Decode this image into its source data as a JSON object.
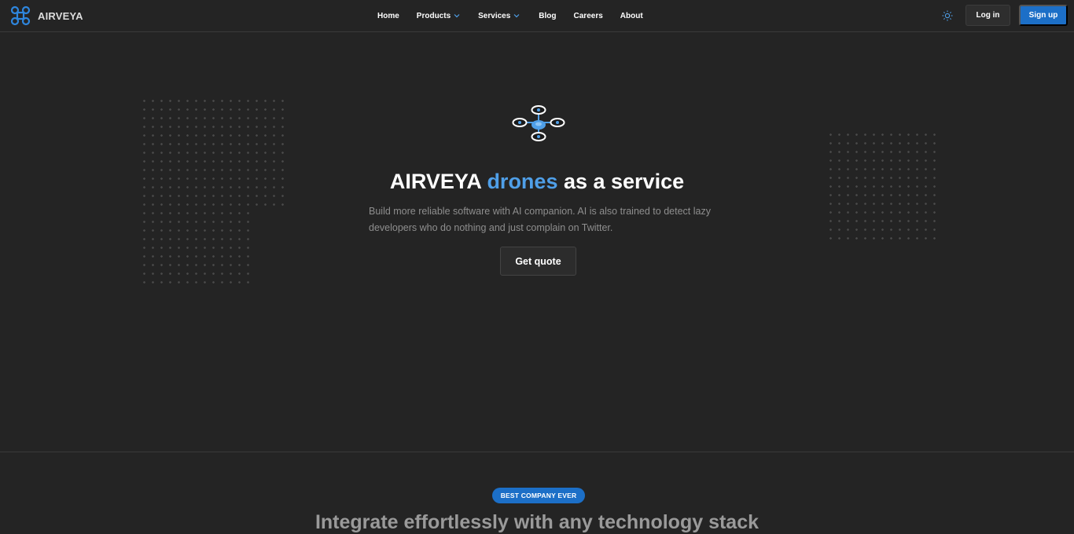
{
  "header": {
    "brand": "AIRVEYA",
    "nav": [
      {
        "label": "Home"
      },
      {
        "label": "Products"
      },
      {
        "label": "Services"
      },
      {
        "label": "Blog"
      },
      {
        "label": "Careers"
      },
      {
        "label": "About"
      }
    ],
    "login_label": "Log in",
    "signup_label": "Sign up",
    "theme_icon": "sun-icon"
  },
  "hero": {
    "title_prefix": "AIRVEYA ",
    "title_accent": "drones",
    "title_suffix": " as a service",
    "subtitle": "Build more reliable software with AI companion. AI is also trained to detect lazy developers who do nothing and just complain on Twitter.",
    "cta_label": "Get quote",
    "icon": "drone-icon"
  },
  "section": {
    "badge": "BEST COMPANY EVER",
    "title": "Integrate effortlessly with any technology stack"
  },
  "colors": {
    "background": "#242424",
    "accent": "#4f9fe8",
    "primary_button": "#1c6fc7"
  }
}
